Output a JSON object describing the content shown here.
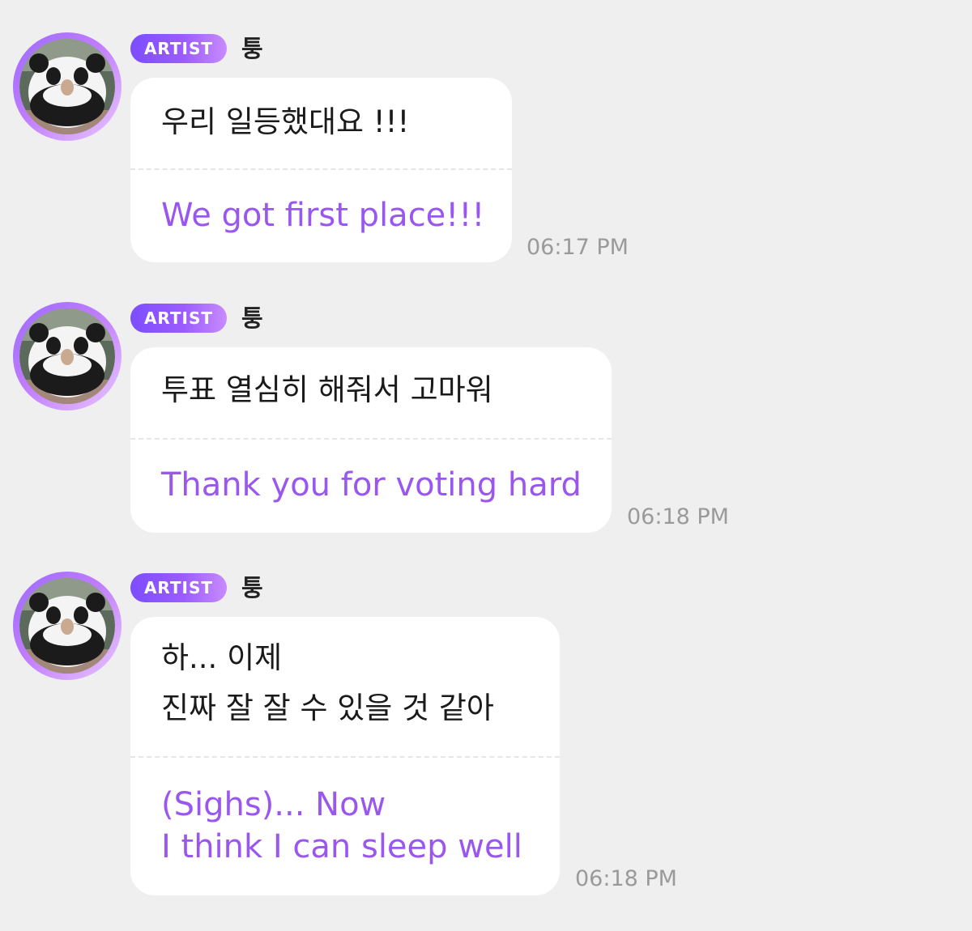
{
  "messages": [
    {
      "badge": "ARTIST",
      "sender": "퉁",
      "korean": "우리 일등했대요 !!!",
      "english": "We got first place!!!",
      "time": "06:17 PM"
    },
    {
      "badge": "ARTIST",
      "sender": "퉁",
      "korean": "투표 열심히 해줘서 고마워",
      "english": "Thank you for voting hard",
      "time": "06:18 PM"
    },
    {
      "badge": "ARTIST",
      "sender": "퉁",
      "korean": "하... 이제\n진짜 잘 잘 수 있을 것 같아",
      "english": "(Sighs)... Now\nI think I can sleep well",
      "time": "06:18 PM"
    }
  ],
  "colors": {
    "background": "#efeff0",
    "bubble": "#ffffff",
    "translation": "#9a57f0",
    "timestamp": "#9a9a9a",
    "badge_gradient": [
      "#7c4dff",
      "#c88bff"
    ]
  },
  "icons": {
    "avatar": "panda-sculpture-avatar"
  }
}
